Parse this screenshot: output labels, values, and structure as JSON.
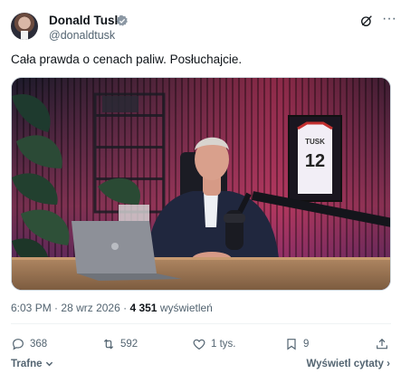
{
  "author": {
    "name": "Donald Tusk",
    "handle": "@donaldtusk"
  },
  "tweet": {
    "text": "Cała prawda o cenach paliw. Posłuchajcie."
  },
  "video": {
    "jersey_name": "TUSK",
    "jersey_number": "12"
  },
  "meta": {
    "time": "6:03 PM",
    "date": "28 wrz 2026",
    "separator": "·",
    "views_count": "4 351",
    "views_label": "wyświetleń"
  },
  "actions": {
    "replies": "368",
    "reposts": "592",
    "likes": "1 tys.",
    "bookmarks": "9"
  },
  "footer": {
    "sort_label": "Trafne",
    "view_quotes": "Wyświetl cytaty"
  },
  "colors": {
    "verified_badge": "#8c98a4",
    "secondary_text": "#536471",
    "primary_text": "#0f1419"
  }
}
